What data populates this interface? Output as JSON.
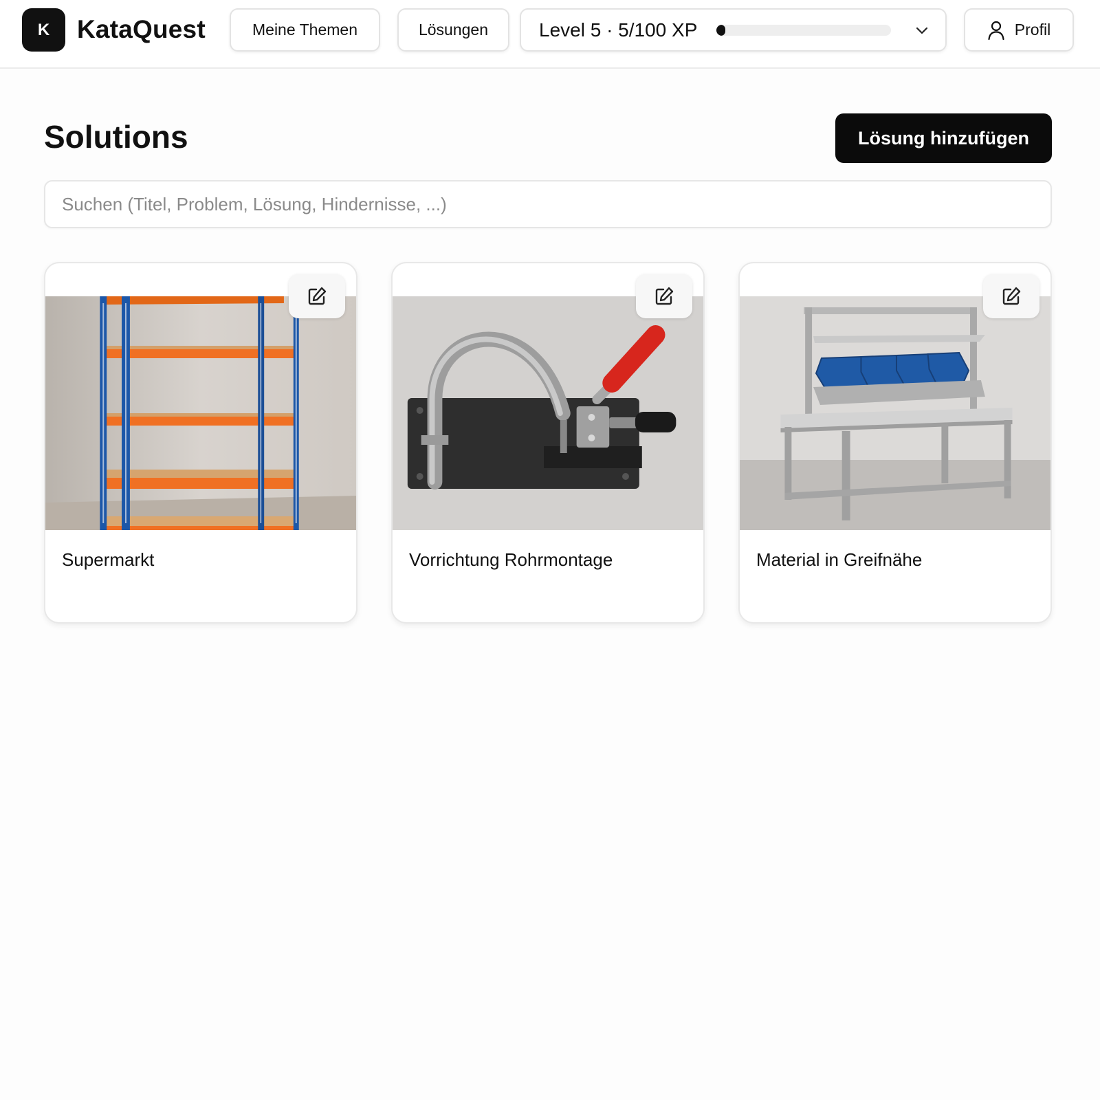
{
  "header": {
    "logo_letter": "K",
    "app_name": "KataQuest",
    "nav": {
      "themes_label": "Meine Themen",
      "solutions_label": "Lösungen"
    },
    "level": {
      "label": "Level 5 · 5/100 XP",
      "xp_current": 5,
      "xp_max": 100,
      "progress_fraction": 0.05
    },
    "profile_label": "Profil"
  },
  "main": {
    "title": "Solutions",
    "add_button_label": "Lösung hinzufügen",
    "search_placeholder": "Suchen (Titel, Problem, Lösung, Hindernisse, ...)"
  },
  "cards": [
    {
      "title": "Supermarkt",
      "image": "storage-shelf"
    },
    {
      "title": "Vorrichtung Rohrmontage",
      "image": "toggle-clamp-fixture"
    },
    {
      "title": "Material in Greifnähe",
      "image": "workbench-with-bins"
    }
  ],
  "colors": {
    "primary": "#0b0b0b",
    "xp_fill": "#111111",
    "xp_track": "#eeeeee",
    "shelf_orange": "#f26a1b",
    "shelf_blue": "#1c57a8",
    "clamp_red": "#d7261d",
    "bin_blue": "#1f5aa6"
  }
}
